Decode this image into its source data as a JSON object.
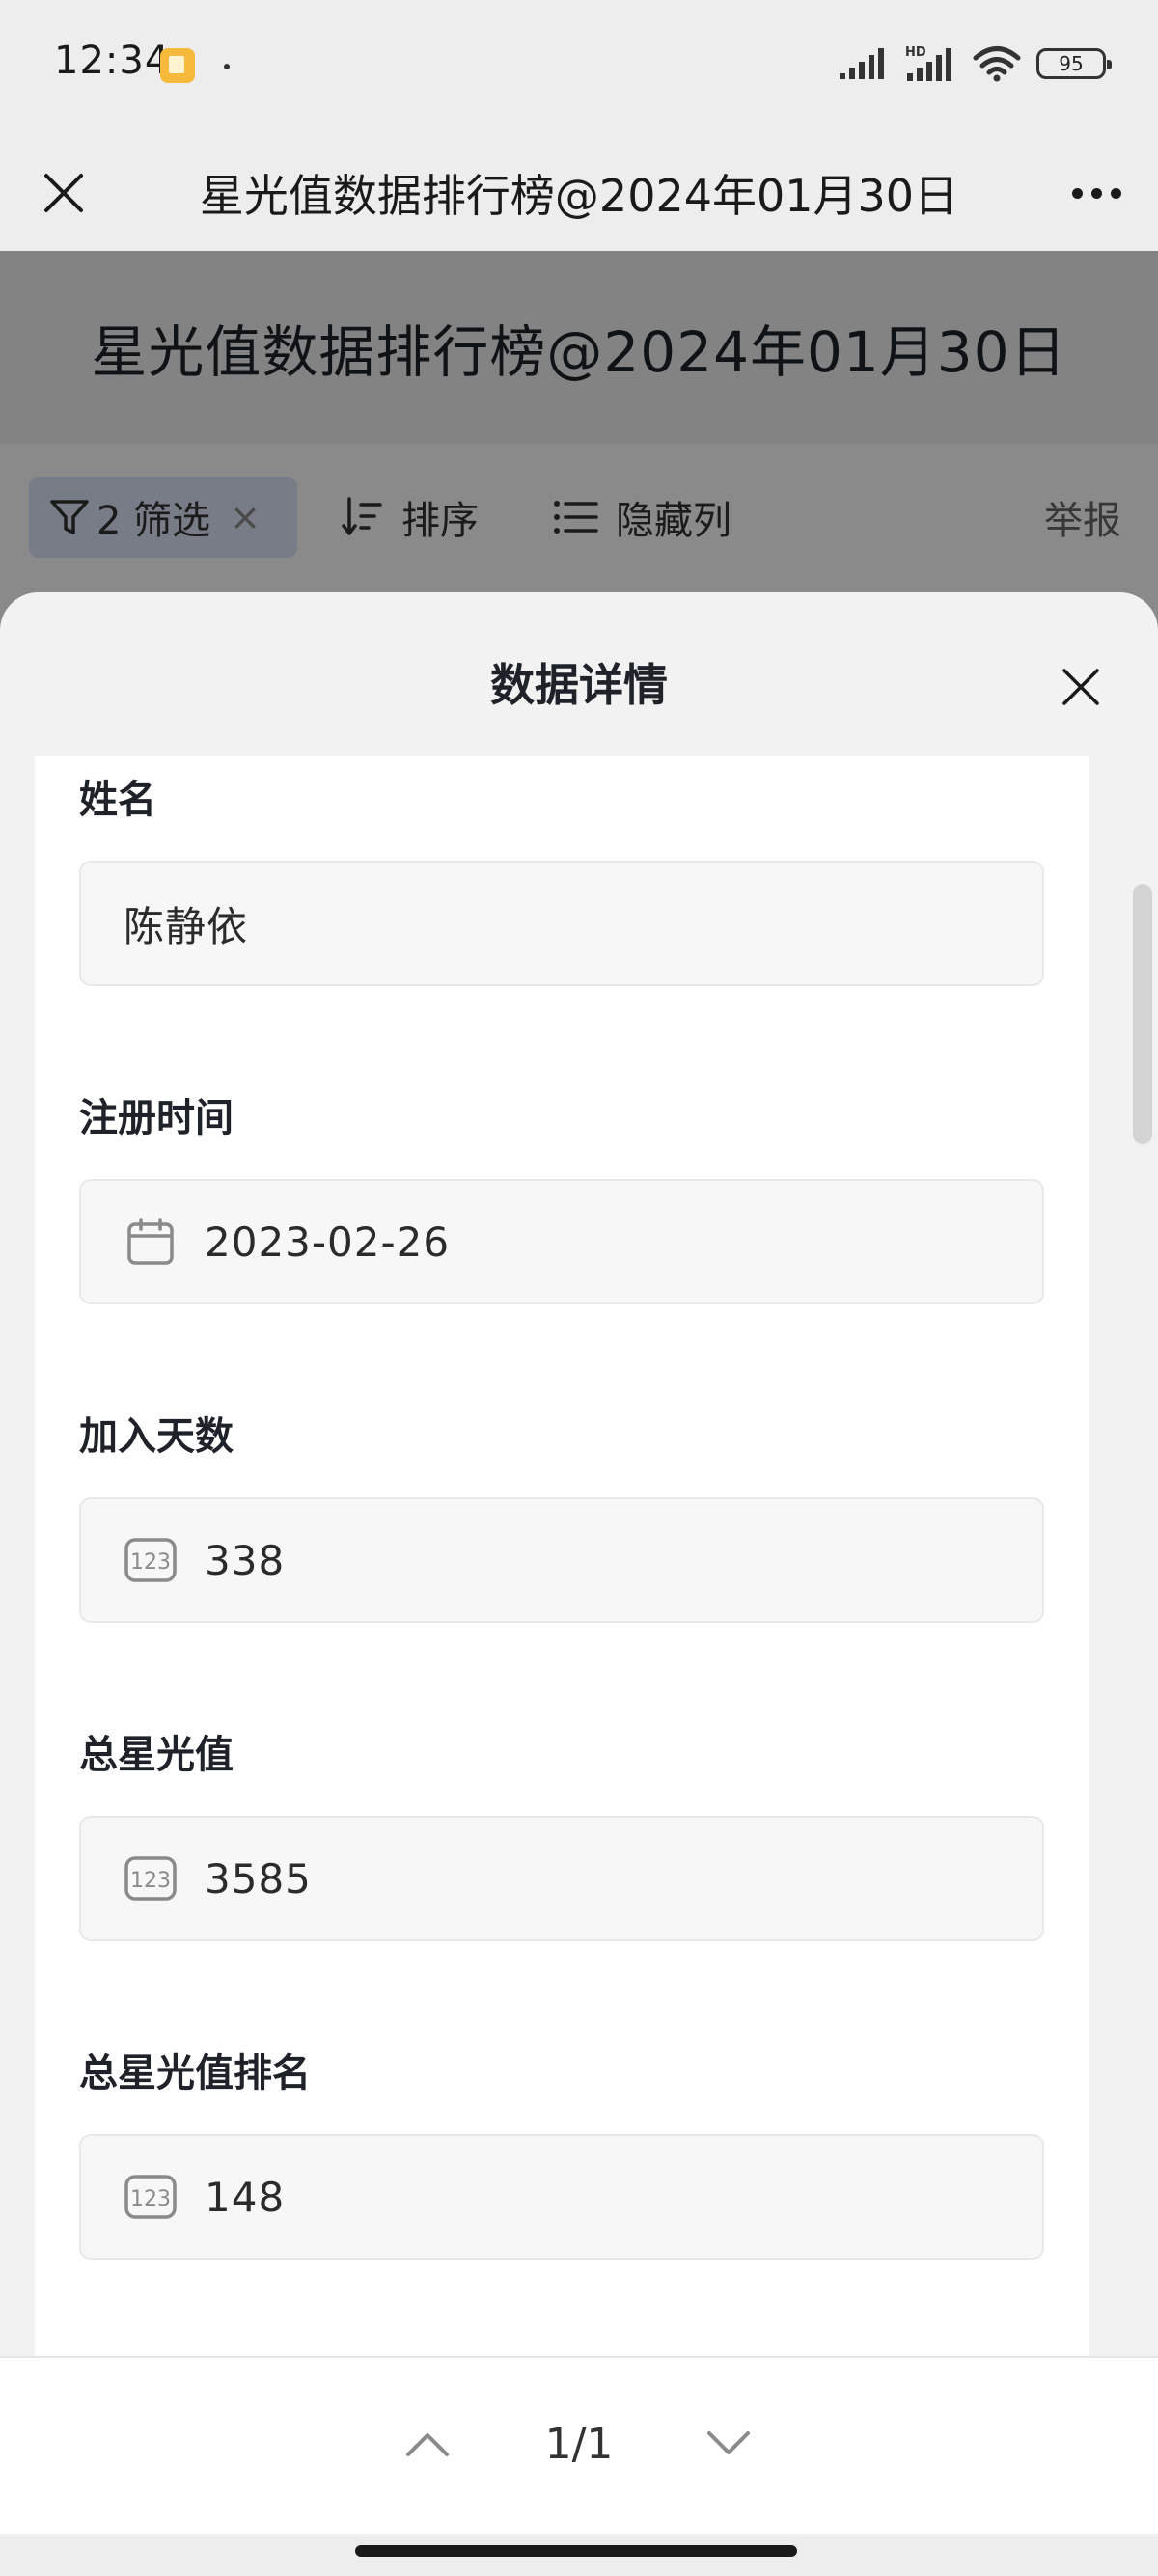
{
  "status_bar": {
    "time": "12:34",
    "battery": "95",
    "network_label": "HD"
  },
  "nav": {
    "title": "星光值数据排行榜@2024年01月30日"
  },
  "page": {
    "title": "星光值数据排行榜@2024年01月30日",
    "toolbar": {
      "filter_label": "2 筛选",
      "filter_clear": "×",
      "sort_label": "排序",
      "hide_columns_label": "隐藏列",
      "report_label": "举报"
    }
  },
  "sheet": {
    "title": "数据详情",
    "fields": [
      {
        "label": "姓名",
        "value": "陈静依",
        "icon": ""
      },
      {
        "label": "注册时间",
        "value": "2023-02-26",
        "icon": "calendar-icon"
      },
      {
        "label": "加入天数",
        "value": "338",
        "icon": "number-icon"
      },
      {
        "label": "总星光值",
        "value": "3585",
        "icon": "number-icon"
      },
      {
        "label": "总星光值排名",
        "value": "148",
        "icon": "number-icon"
      }
    ]
  },
  "pager": {
    "count": "1/1"
  },
  "colors": {
    "filter_chip_bg": "#dde5f8",
    "sheet_bg": "#f2f2f2",
    "field_bg": "#f7f7f7"
  }
}
